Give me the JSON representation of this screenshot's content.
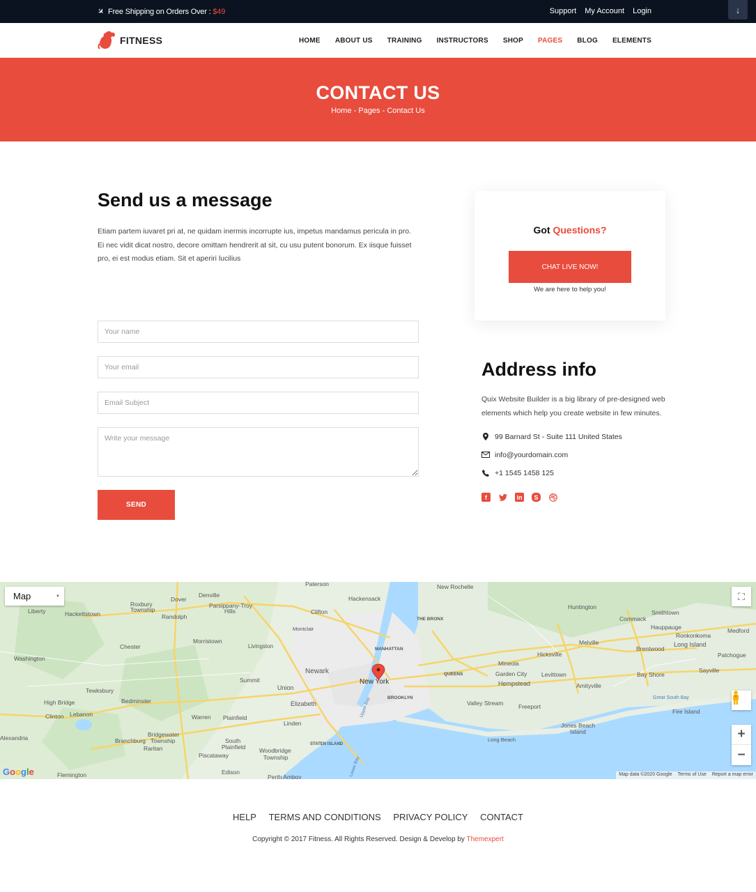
{
  "topbar": {
    "shipping_text": "Free Shipping on Orders Over : ",
    "shipping_price": "$49",
    "links": [
      "Support",
      "My Account",
      "Login"
    ],
    "download_icon": "↓"
  },
  "brand": {
    "name": "FITNESS",
    "accent": "#e84c3d"
  },
  "nav": {
    "items": [
      "HOME",
      "ABOUT US",
      "TRAINING",
      "INSTRUCTORS",
      "SHOP",
      "PAGES",
      "BLOG",
      "ELEMENTS"
    ],
    "active": "PAGES"
  },
  "hero": {
    "title": "CONTACT US",
    "breadcrumb": [
      "Home",
      "Pages",
      "Contact Us"
    ],
    "separator": " - "
  },
  "message": {
    "heading": "Send us a message",
    "body": "Etiam partem iuvaret pri at, ne quidam inermis incorrupte ius, impetus mandamus pericula in pro. Ei nec vidit dicat nostro, decore omittam hendrerit at sit, cu usu putent bonorum. Ex iisque fuisset pro, ei est modus etiam. Sit et aperiri lucilius"
  },
  "form": {
    "name_placeholder": "Your name",
    "name_value": "",
    "email_placeholder": "Your email",
    "email_value": "",
    "subject_placeholder": "Email Subject",
    "subject_value": "",
    "message_placeholder": "Write your message",
    "message_value": "",
    "send_label": "SEND"
  },
  "card": {
    "title_plain": "Got ",
    "title_accent": "Questions?",
    "button_label": "CHAT LIVE NOW!",
    "note": "We are here to help you!"
  },
  "address": {
    "heading": "Address info",
    "body": "Quix Website Builder is a big library of pre-designed web elements which help you create website in few minutes.",
    "location": "99 Barnard St - Suite 111 United States",
    "email": "info@yourdomain.com",
    "phone": "+1 1545 1458 125",
    "social": [
      "facebook",
      "twitter",
      "linkedin",
      "skype",
      "dribbble"
    ]
  },
  "map": {
    "type_label": "Map",
    "pin_label": "New York",
    "places": [
      "Paterson",
      "New Rochelle",
      "Hackensack",
      "Clifton",
      "Montclair",
      "THE BRONX",
      "MANHATTAN",
      "Newark",
      "New York",
      "QUEENS",
      "BROOKLYN",
      "Union",
      "Elizabeth",
      "Linden",
      "STATEN ISLAND",
      "Woodbridge Township",
      "Perth Amboy",
      "Huntington",
      "Commack",
      "Smithtown",
      "Hauppauge",
      "Ronkonkoma",
      "Medford",
      "Melville",
      "Hicksville",
      "Brentwood",
      "Long Island",
      "Patchogue",
      "Mineola",
      "Garden City",
      "Levittown",
      "Hempstead",
      "Bay Shore",
      "Sayville",
      "Valley Stream",
      "Freeport",
      "Amityville",
      "Great South Bay",
      "Fire Island",
      "Jones Beach Island",
      "Long Beach",
      "Liberty",
      "Hackettstown",
      "Roxbury Township",
      "Dover",
      "Denville",
      "Parsippany-Troy Hills",
      "Randolph",
      "Morristown",
      "Chester",
      "Washington",
      "Livingston",
      "Summit",
      "Tewksbury",
      "High Bridge",
      "Clinton",
      "Lebanon",
      "Bedminster",
      "Warren",
      "Plainfield",
      "Bridgewater Township",
      "Branchburg",
      "Raritan",
      "South Plainfield",
      "Piscataway",
      "Edison",
      "Alexandria",
      "Flemington",
      "Upper Bay",
      "Lower Bay"
    ],
    "attribution": [
      "Map data ©2020 Google",
      "Terms of Use",
      "Report a map error"
    ],
    "zoom_in": "+",
    "zoom_out": "−"
  },
  "footer": {
    "links": [
      "HELP",
      "TERMS AND CONDITIONS",
      "PRIVACY POLICY",
      "CONTACT"
    ],
    "copyright": "Copyright © 2017 Fitness. All Rights Reserved. Design & Develop by ",
    "credit": "Themexpert"
  }
}
